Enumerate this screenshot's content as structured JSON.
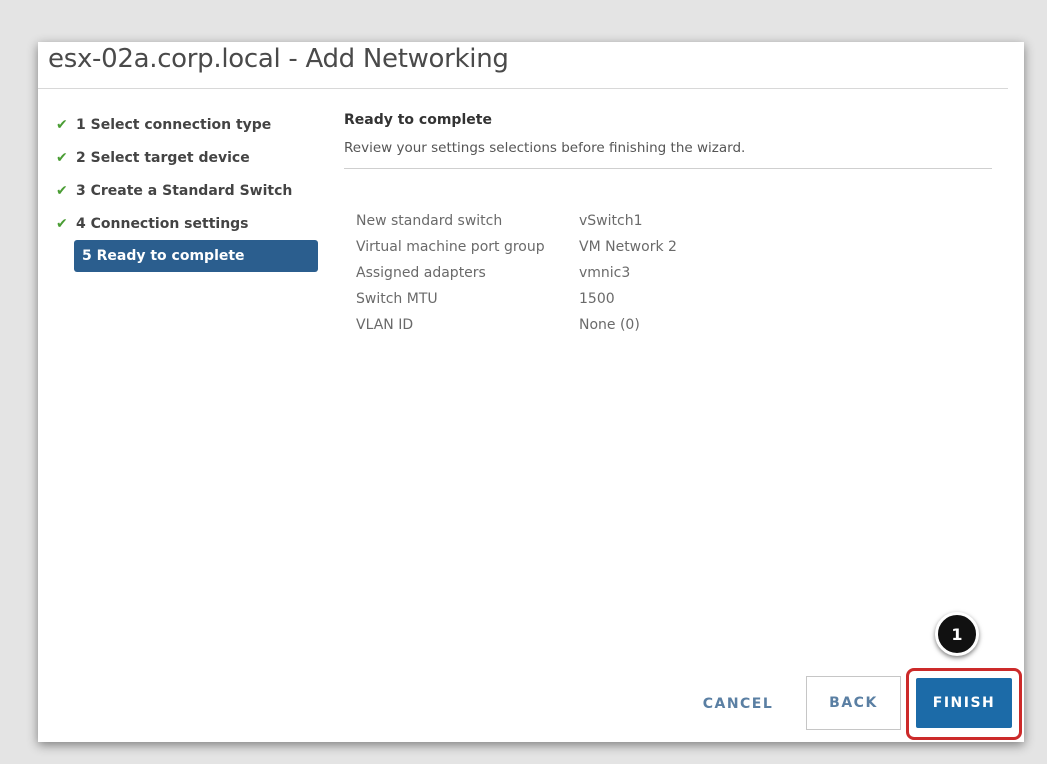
{
  "dialog": {
    "title": "esx-02a.corp.local - Add Networking"
  },
  "steps": [
    {
      "label": "1 Select connection type",
      "completed": true
    },
    {
      "label": "2 Select target device",
      "completed": true
    },
    {
      "label": "3 Create a Standard Switch",
      "completed": true
    },
    {
      "label": "4 Connection settings",
      "completed": true
    },
    {
      "label": "5 Ready to complete",
      "completed": false,
      "active": true
    }
  ],
  "check_icon": "✔",
  "content": {
    "heading": "Ready to complete",
    "subheading": "Review your settings selections before finishing the wizard."
  },
  "summary": [
    {
      "key": "New standard switch",
      "value": "vSwitch1"
    },
    {
      "key": "Virtual machine port group",
      "value": "VM Network 2"
    },
    {
      "key": "Assigned adapters",
      "value": "vmnic3"
    },
    {
      "key": "Switch MTU",
      "value": "1500"
    },
    {
      "key": "VLAN ID",
      "value": "None (0)"
    }
  ],
  "footer": {
    "cancel_label": "CANCEL",
    "back_label": "BACK",
    "finish_label": "FINISH"
  },
  "callout": {
    "number": "1"
  },
  "colors": {
    "accent": "#1c6ba8",
    "active_step": "#2b5e8e",
    "check": "#4a9d34",
    "highlight": "#cc2a2a"
  }
}
